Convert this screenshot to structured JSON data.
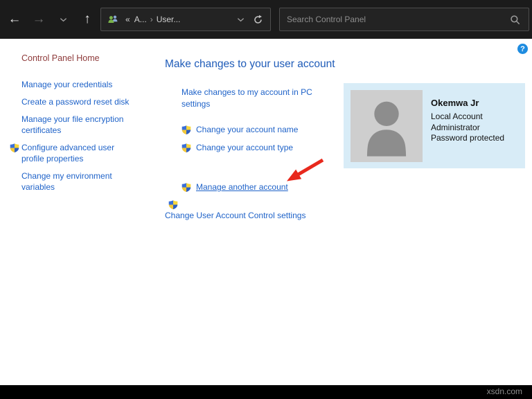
{
  "toolbar": {
    "icons": {
      "back": "←",
      "forward": "→",
      "up": "↑"
    },
    "breadcrumb": {
      "overflow": "«",
      "root": "A...",
      "separator": "›",
      "current": "User..."
    },
    "search": {
      "placeholder": "Search Control Panel"
    }
  },
  "sidebar": {
    "home_label": "Control Panel Home",
    "items": [
      {
        "label": "Manage your credentials",
        "shield": false
      },
      {
        "label": "Create a password reset disk",
        "shield": false
      },
      {
        "label": "Manage your file encryption certificates",
        "shield": false
      },
      {
        "label": "Configure advanced user profile properties",
        "shield": true
      },
      {
        "label": "Change my environment variables",
        "shield": false
      }
    ]
  },
  "main": {
    "title": "Make changes to your user account",
    "pc_settings_link": "Make changes to my account in PC settings",
    "links": [
      "Change your account name",
      "Change your account type",
      "Manage another account",
      "Change User Account Control settings"
    ],
    "help_label": "?",
    "account": {
      "name": "Okemwa Jr",
      "lines": [
        "Local Account",
        "Administrator",
        "Password protected"
      ]
    }
  },
  "watermark": "xsdn.com",
  "colors": {
    "toolbar_bg": "#1b1b1b",
    "link_blue": "#1e62c8",
    "title_blue": "#1e5bb8",
    "home_maroon": "#8e3b3b",
    "account_box_bg": "#d8ecf7",
    "help_blue": "#1e8ce0",
    "annotation_red": "#e8291d"
  }
}
